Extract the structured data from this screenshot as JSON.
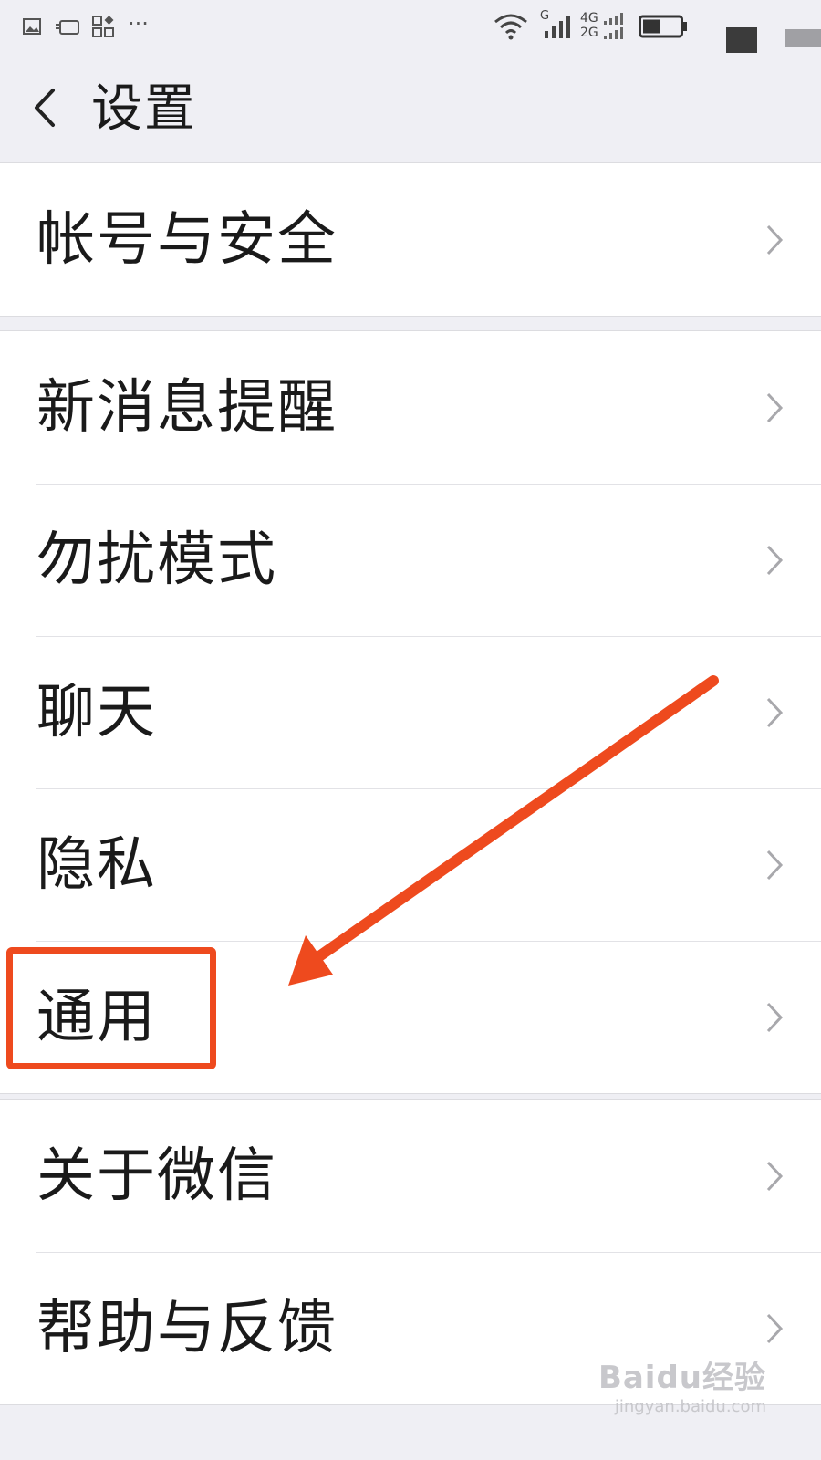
{
  "status_bar": {
    "overflow_dots": "···",
    "network_g": "G",
    "network_4g": "4G",
    "network_2g": "2G",
    "battery_level": 0.45
  },
  "nav": {
    "title": "设置",
    "back_icon": "back-chevron-icon"
  },
  "groups": [
    {
      "items": [
        {
          "label": "帐号与安全"
        }
      ]
    },
    {
      "items": [
        {
          "label": "新消息提醒"
        },
        {
          "label": "勿扰模式"
        },
        {
          "label": "聊天"
        },
        {
          "label": "隐私"
        },
        {
          "label": "通用"
        }
      ]
    },
    {
      "items": [
        {
          "label": "关于微信"
        },
        {
          "label": "帮助与反馈"
        }
      ]
    }
  ],
  "annotation": {
    "color": "#ee4a1e",
    "target": "通用"
  },
  "watermark": {
    "logo": "Baidu经验",
    "url": "jingyan.baidu.com"
  },
  "colors": {
    "background": "#efeff4",
    "row_background": "#ffffff",
    "text": "#1a1a1a",
    "chevron": "#a8a8ac"
  }
}
